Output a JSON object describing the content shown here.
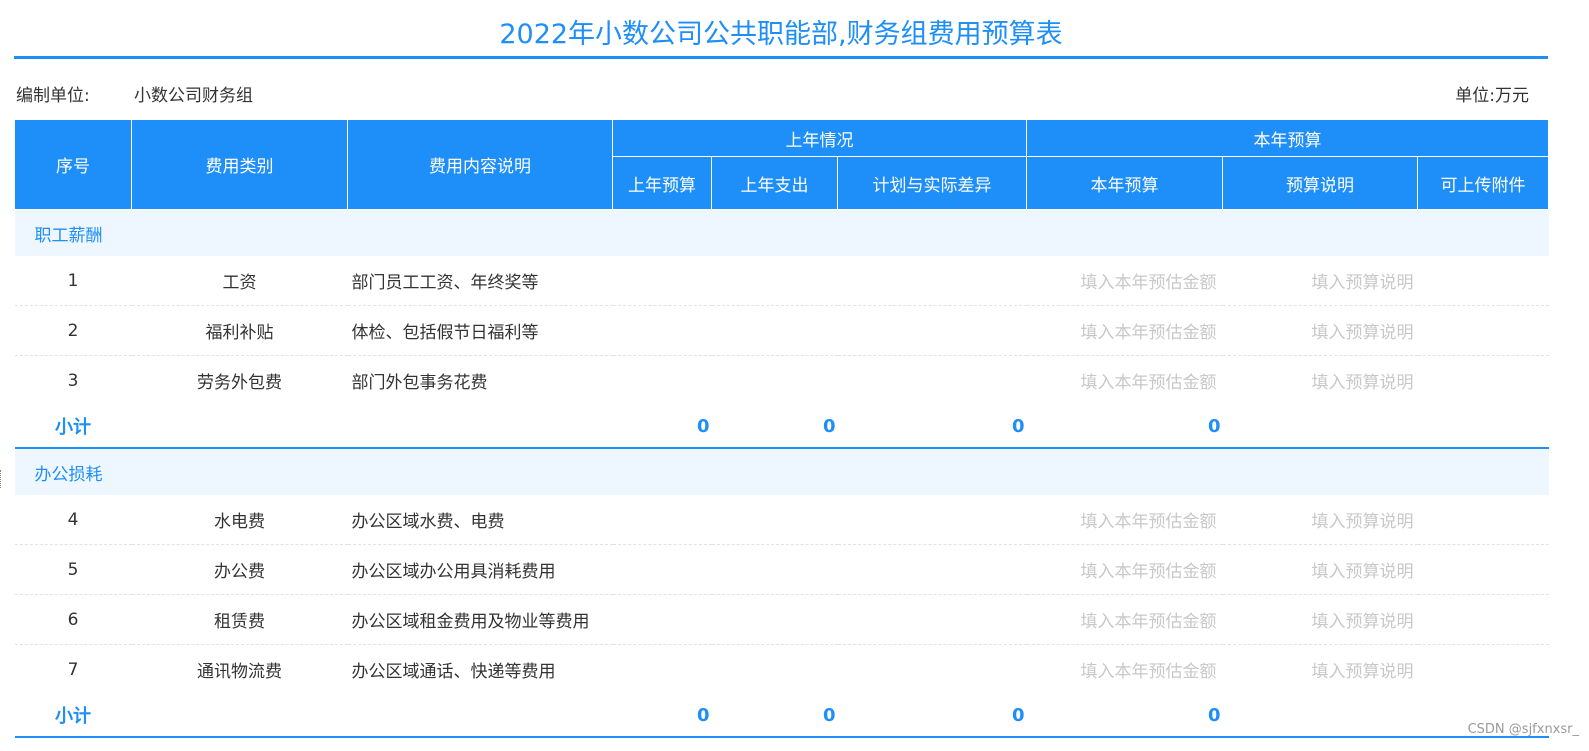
{
  "page": {
    "title": "2022年小数公司公共职能部,财务组费用预算表",
    "unit_label": "编制单位:",
    "unit_value": "小数公司财务组",
    "currency": "单位:万元",
    "watermark": "CSDN @sjfxnxsr_"
  },
  "header": {
    "seq": "序号",
    "category": "费用类别",
    "description": "费用内容说明",
    "last_year": "上年情况",
    "this_year": "本年预算",
    "last_budget": "上年预算",
    "last_spend": "上年支出",
    "diff": "计划与实际差异",
    "budget": "本年预算",
    "note": "预算说明",
    "attach": "可上传附件"
  },
  "placeholders": {
    "amount": "填入本年预估金额",
    "note": "填入预算说明"
  },
  "groups": [
    {
      "name": "职工薪酬",
      "rows": [
        {
          "seq": "1",
          "category": "工资",
          "desc": "部门员工工资、年终奖等"
        },
        {
          "seq": "2",
          "category": "福利补贴",
          "desc": "体检、包括假节日福利等"
        },
        {
          "seq": "3",
          "category": "劳务外包费",
          "desc": "部门外包事务花费"
        }
      ],
      "subtotal": {
        "label": "小计",
        "last_budget": "0",
        "last_spend": "0",
        "diff": "0",
        "budget": "0"
      }
    },
    {
      "name": "办公损耗",
      "rows": [
        {
          "seq": "4",
          "category": "水电费",
          "desc": "办公区域水费、电费"
        },
        {
          "seq": "5",
          "category": "办公费",
          "desc": "办公区域办公用具消耗费用"
        },
        {
          "seq": "6",
          "category": "租赁费",
          "desc": "办公区域租金费用及物业等费用"
        },
        {
          "seq": "7",
          "category": "通讯物流费",
          "desc": "办公区域通话、快递等费用"
        }
      ],
      "subtotal": {
        "label": "小计",
        "last_budget": "0",
        "last_spend": "0",
        "diff": "0",
        "budget": "0"
      }
    }
  ]
}
